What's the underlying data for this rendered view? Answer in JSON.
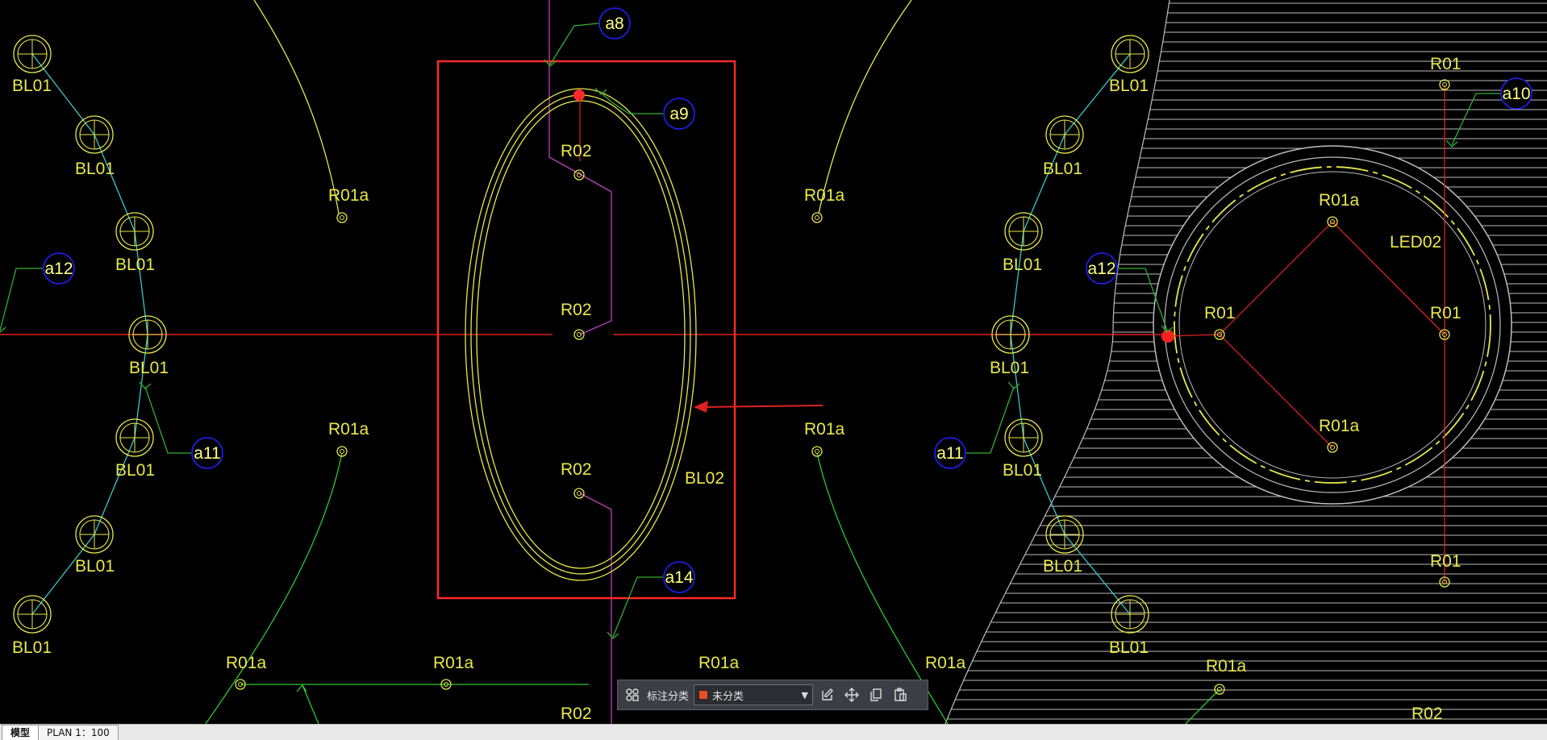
{
  "colors": {
    "background": "#000000",
    "selection_box": "#ff2a2a",
    "ellipse": "#e8e84a",
    "text_yellow": "#e8e84a",
    "leader_green": "#30b030",
    "tag_circle": "#2020ff",
    "fixture_cyan": "#38c8c8",
    "wire_magenta": "#c040c0",
    "arc_green": "#2ec82e",
    "axis_red": "#e02020",
    "hatch_grey": "#bdbdbd"
  },
  "labels": {
    "bl01": "BL01",
    "bl02": "BL02",
    "r01": "R01",
    "r01a": "R01a",
    "r02": "R02",
    "led02": "LED02"
  },
  "tags": {
    "a8": "a8",
    "a9": "a9",
    "a10": "a10",
    "a11": "a11",
    "a12": "a12",
    "a14": "a14"
  },
  "toolbar": {
    "group_icon": "group-icon",
    "label": "标注分类",
    "category_value": "未分类",
    "category_color": "#e8501e",
    "edit_icon": "edit-icon",
    "move_icon": "move-icon",
    "copy_icon": "copy-icon",
    "paste_icon": "paste-icon"
  },
  "tabs": [
    {
      "label": "模型",
      "active": true
    },
    {
      "label": "PLAN 1：100",
      "active": false
    }
  ]
}
